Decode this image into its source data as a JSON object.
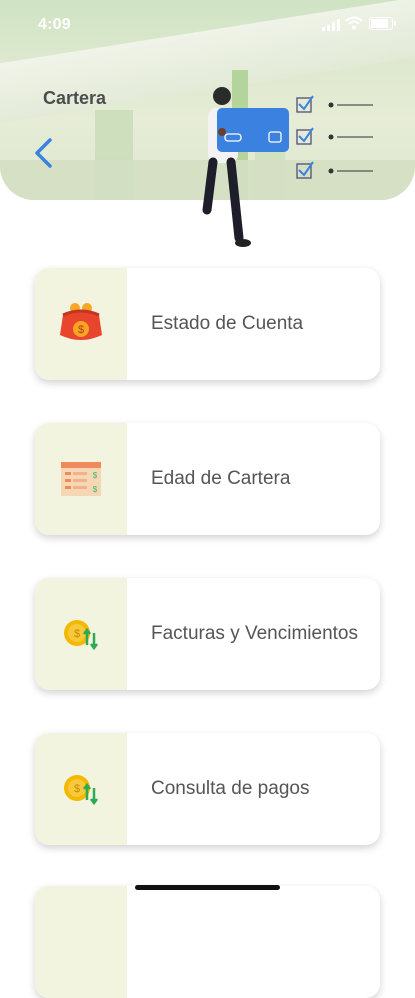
{
  "status_bar": {
    "time": "4:09"
  },
  "header": {
    "title": "Cartera"
  },
  "menu": [
    {
      "label": "Estado de Cuenta",
      "icon": "coin-purse-icon"
    },
    {
      "label": "Edad de Cartera",
      "icon": "spreadsheet-dollar-icon"
    },
    {
      "label": "Facturas y Vencimientos",
      "icon": "coin-exchange-icon"
    },
    {
      "label": "Consulta de pagos",
      "icon": "coin-exchange-icon"
    },
    {
      "label": "",
      "icon": ""
    }
  ],
  "colors": {
    "accent": "#3b82e0",
    "icon_pane": "#f2f4e0",
    "label_text": "#555555"
  }
}
